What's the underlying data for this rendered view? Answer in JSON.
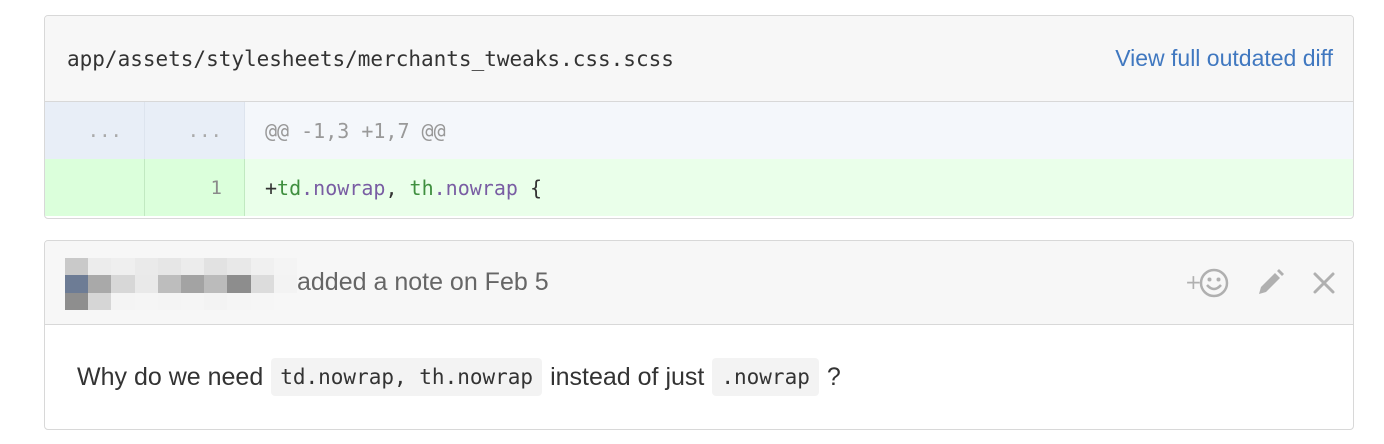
{
  "diff": {
    "file_path": "app/assets/stylesheets/merchants_tweaks.css.scss",
    "view_full_link": "View full outdated diff",
    "hunk": {
      "old_num": "...",
      "new_num": "...",
      "header": "@@ -1,3 +1,7 @@"
    },
    "addition_line": {
      "old_num": "",
      "new_num": "1",
      "prefix": "+",
      "tokens": [
        "td",
        ".nowrap",
        ", ",
        "th",
        ".nowrap",
        " {"
      ]
    }
  },
  "note": {
    "meta_text": "added a note on Feb 5",
    "body": {
      "prefix": "Why do we need",
      "code1": "td.nowrap, th.nowrap",
      "middle": "instead of just",
      "code2": ".nowrap",
      "suffix": "?"
    },
    "actions": {
      "reaction_icon": "add-reaction-icon",
      "edit_icon": "pencil-icon",
      "close_icon": "close-icon"
    }
  },
  "colors": {
    "link": "#4078c0",
    "addition_bg": "#eaffea",
    "hunk_bg": "#f4f7fb"
  }
}
